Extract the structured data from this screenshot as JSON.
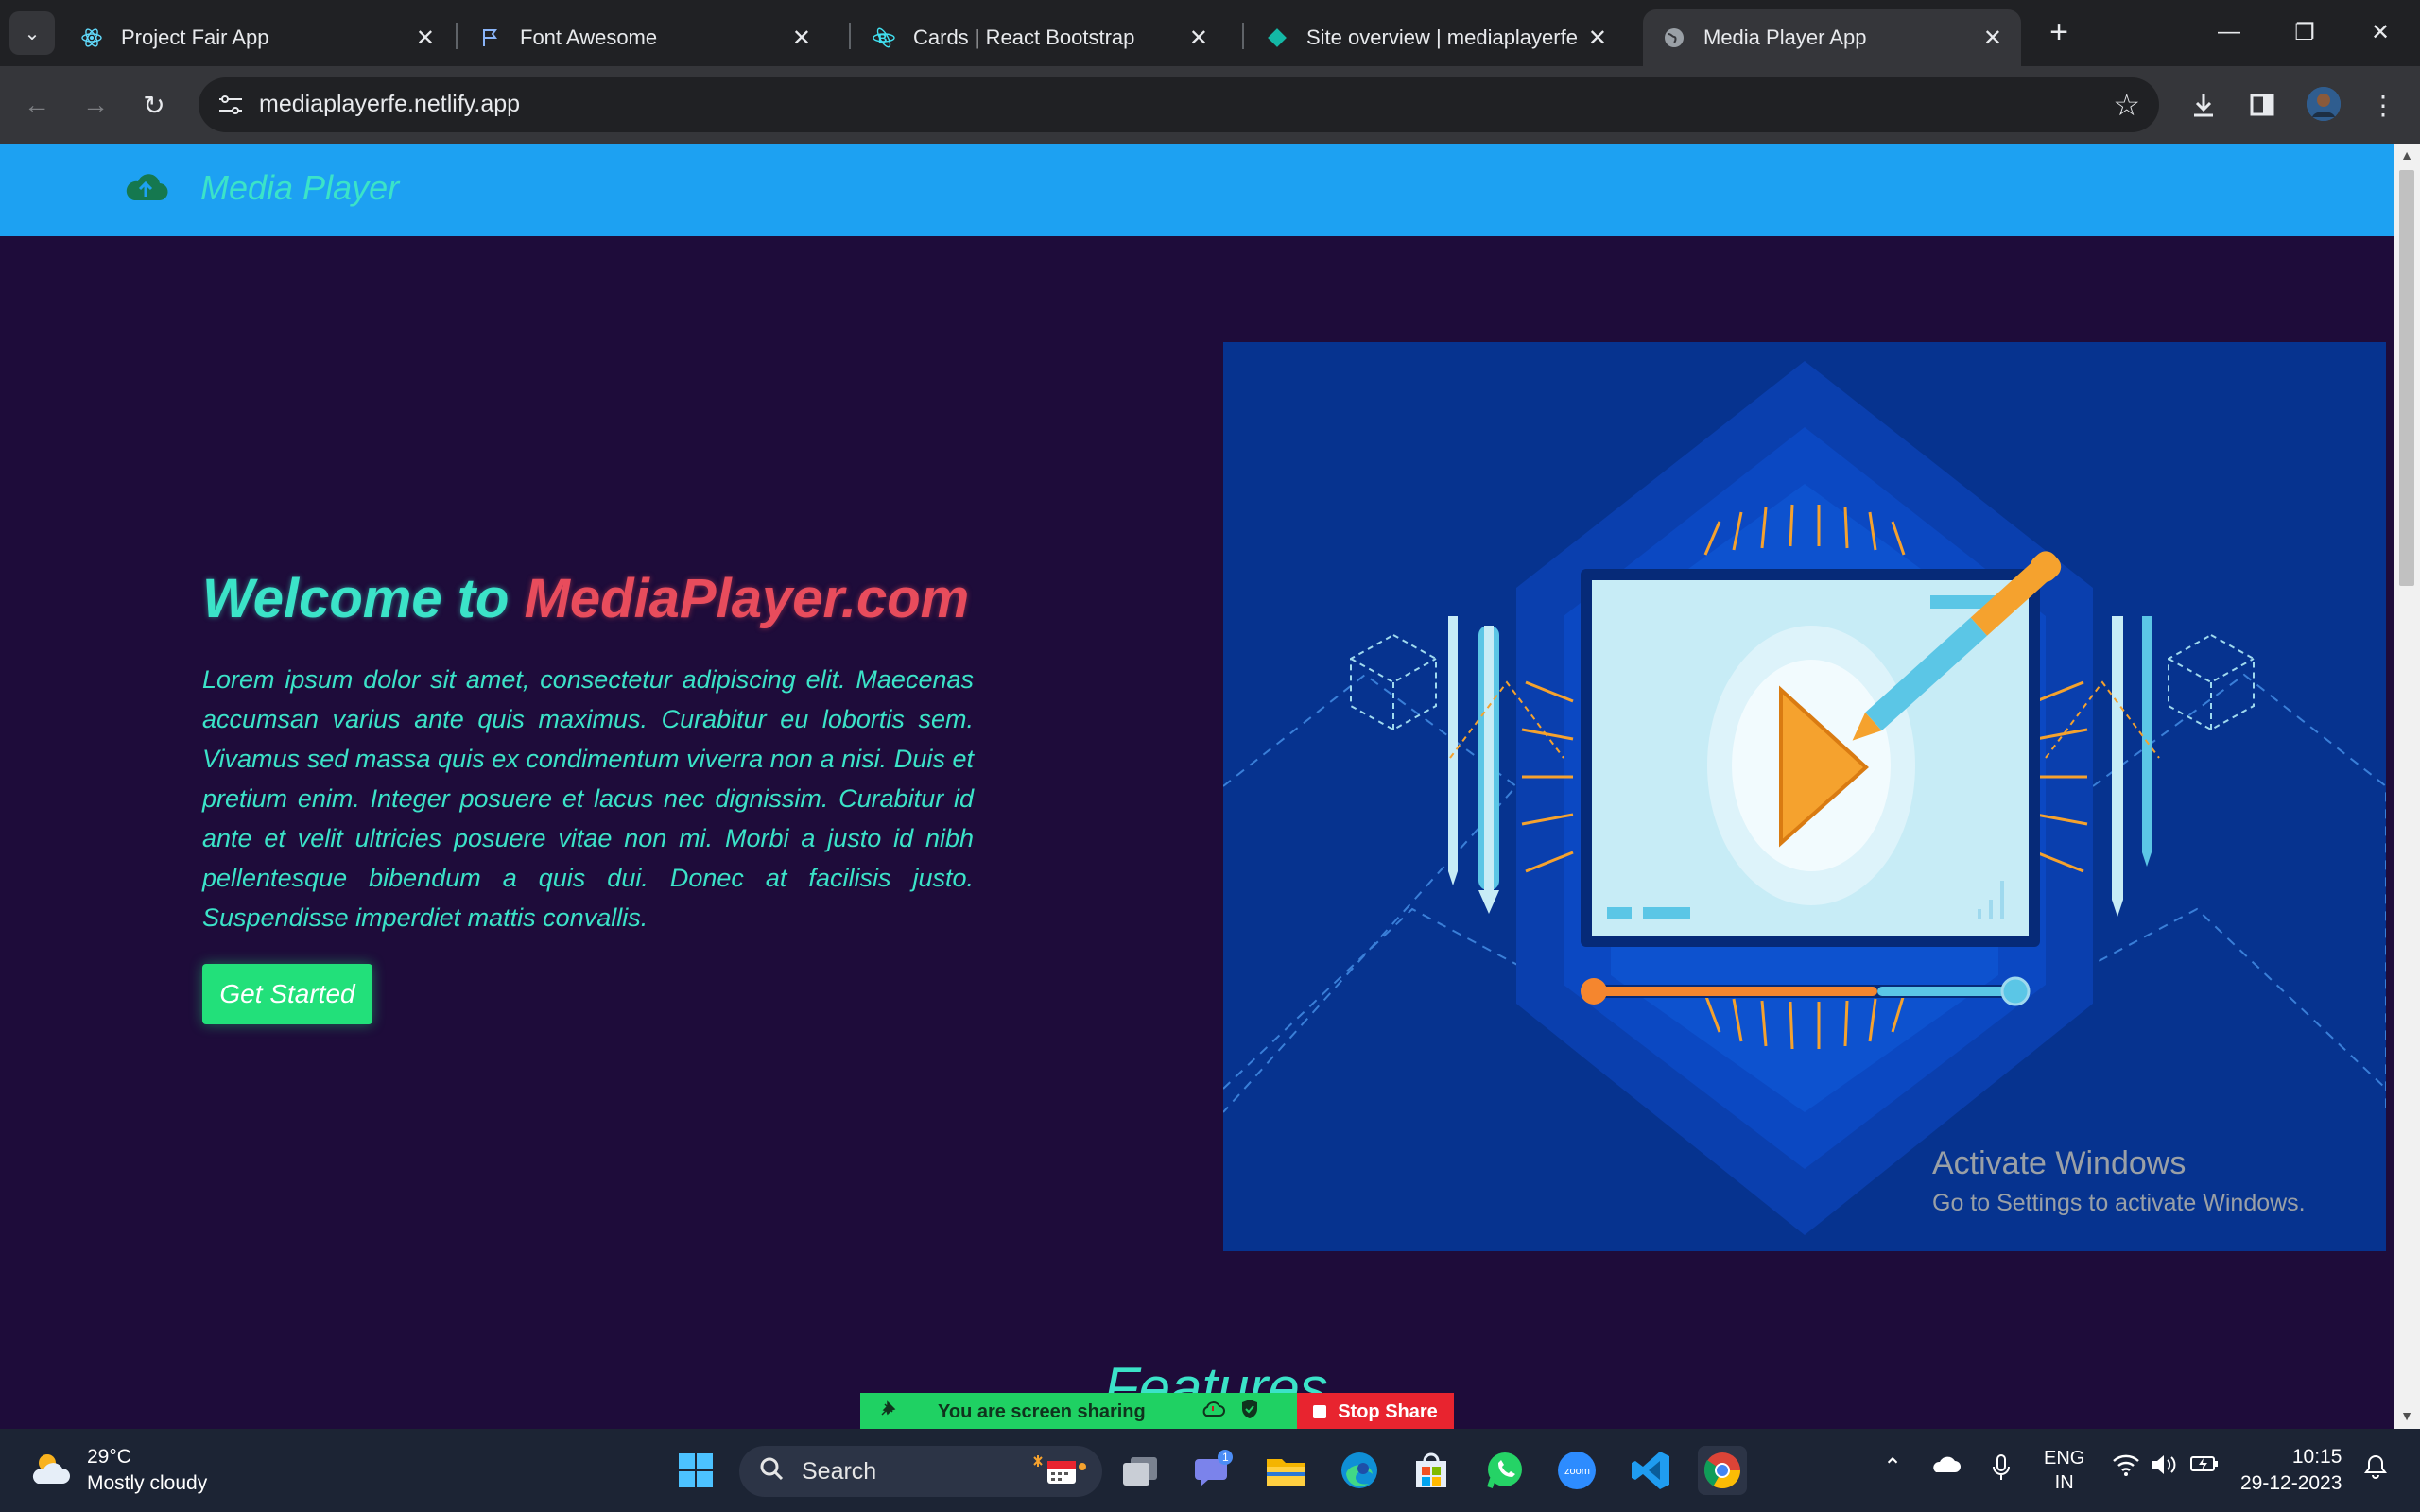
{
  "browser": {
    "tabs": [
      {
        "title": "Project Fair App",
        "icon": "react-icon"
      },
      {
        "title": "Font Awesome",
        "icon": "flag-icon"
      },
      {
        "title": "Cards | React Bootstrap",
        "icon": "react-bootstrap-icon"
      },
      {
        "title": "Site overview | mediaplayerfe | N",
        "icon": "netlify-icon"
      },
      {
        "title": "Media Player App",
        "icon": "globe-icon"
      }
    ],
    "url": "mediaplayerfe.netlify.app"
  },
  "site": {
    "brand": "Media Player",
    "hero": {
      "title_part1": "Welcome to ",
      "title_part2": "MediaPlayer.com",
      "body": "Lorem ipsum dolor sit amet, consectetur adipiscing elit. Maecenas accumsan varius ante quis maximus. Curabitur eu lobortis sem. Vivamus sed massa quis ex condimentum viverra non a nisi. Duis et pretium enim. Integer posuere et lacus nec dignissim. Curabitur id ante et velit ultricies posuere vitae non mi. Morbi a justo id nibh pellentesque bibendum a quis dui. Donec at facilisis justo. Suspendisse imperdiet mattis convallis.",
      "cta": "Get Started"
    },
    "features_heading": "Features"
  },
  "overlay": {
    "activate_title": "Activate Windows",
    "activate_sub": "Go to Settings to activate Windows.",
    "share_label": "You are screen sharing",
    "stop_share": "Stop Share"
  },
  "taskbar": {
    "temperature": "29°C",
    "weather": "Mostly cloudy",
    "search_placeholder": "Search",
    "teams_badge": "1",
    "language_line1": "ENG",
    "language_line2": "IN",
    "time": "10:15",
    "date": "29-12-2023"
  },
  "colors": {
    "nav_bg": "#1da1f2",
    "page_bg": "#1e0c3a",
    "accent_teal": "#3be3c8",
    "accent_red": "#e84c5c",
    "cta_green": "#22e07a",
    "illustration_bg": "#06338f"
  }
}
